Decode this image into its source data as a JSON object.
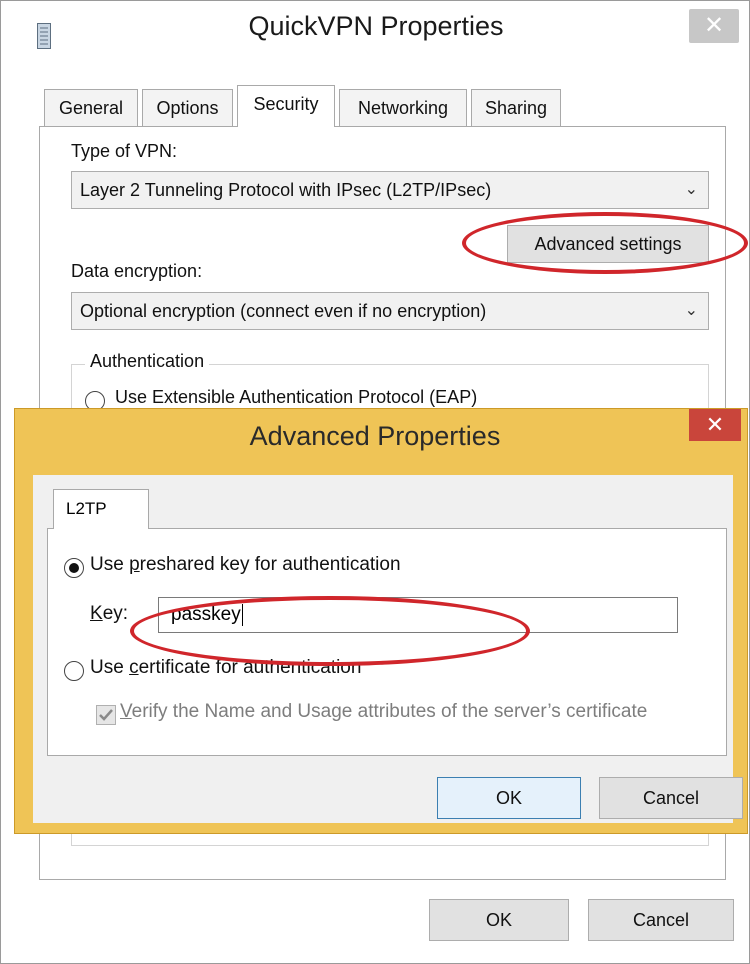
{
  "main_window": {
    "title": "QuickVPN Properties",
    "icon": "document-icon",
    "close_symbol": "✕",
    "tabs": [
      {
        "label": "General",
        "active": false
      },
      {
        "label": "Options",
        "active": false
      },
      {
        "label": "Security",
        "active": true
      },
      {
        "label": "Networking",
        "active": false
      },
      {
        "label": "Sharing",
        "active": false
      }
    ],
    "security": {
      "vpn_type_label": "Type of VPN:",
      "vpn_type_value": "Layer 2 Tunneling Protocol with IPsec (L2TP/IPsec)",
      "advanced_settings_button": "Advanced settings",
      "data_encryption_label": "Data encryption:",
      "data_encryption_value": "Optional encryption (connect even if no encryption)",
      "authentication_group_label": "Authentication",
      "eap_option": "Use Extensible Authentication Protocol (EAP)"
    },
    "ok_button": "OK",
    "cancel_button": "Cancel"
  },
  "advanced_dialog": {
    "title": "Advanced Properties",
    "close_symbol": "✕",
    "tab_label": "L2TP",
    "preshared_option": {
      "label_before": "Use ",
      "accesskey": "p",
      "label_after": "reshared key for authentication",
      "selected": true
    },
    "key_label": {
      "accesskey": "K",
      "rest": "ey:"
    },
    "key_value": "passkey",
    "certificate_option": {
      "label_before": "Use ",
      "accesskey": "c",
      "label_after": "ertificate for authentication",
      "selected": false
    },
    "verify_checkbox": {
      "accesskey": "V",
      "rest": "erify the Name and Usage attributes of the server’s certificate",
      "checked": true,
      "disabled": true
    },
    "ok_button": "OK",
    "cancel_button": "Cancel"
  },
  "annotation_color": "#d0262b",
  "accent_color": "#efc456"
}
